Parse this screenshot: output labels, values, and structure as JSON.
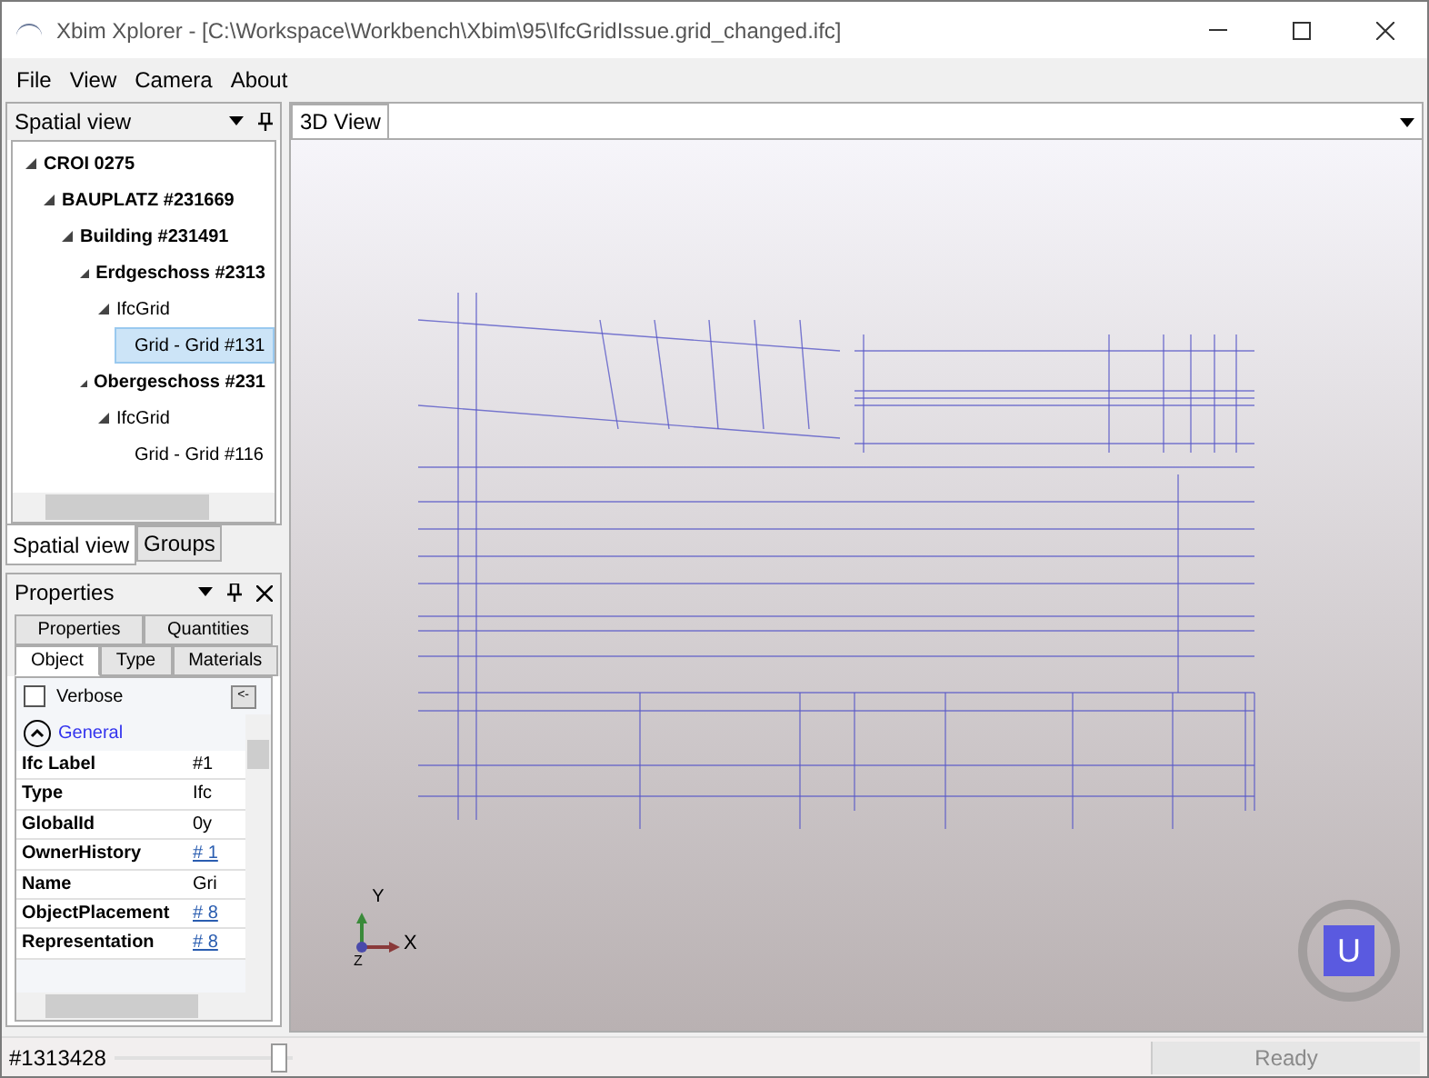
{
  "window": {
    "title": "Xbim Xplorer - [C:\\Workspace\\Workbench\\Xbim\\95\\IfcGridIssue.grid_changed.ifc]"
  },
  "menu": [
    "File",
    "View",
    "Camera",
    "About"
  ],
  "spatial_panel": {
    "title": "Spatial view",
    "tree": [
      {
        "label": "CROI 0275",
        "bold": true,
        "expanded": true,
        "selected": false,
        "children": [
          {
            "label": "BAUPLATZ #231669",
            "bold": true,
            "expanded": true,
            "selected": false,
            "children": [
              {
                "label": "Building #231491",
                "bold": true,
                "expanded": true,
                "selected": false,
                "children": [
                  {
                    "label": "Erdgeschoss #2313",
                    "bold": true,
                    "expanded": true,
                    "selected": false,
                    "children": [
                      {
                        "label": "IfcGrid",
                        "bold": false,
                        "expanded": true,
                        "selected": false,
                        "children": [
                          {
                            "label": "Grid - Grid #131",
                            "bold": false,
                            "selected": true
                          }
                        ]
                      }
                    ]
                  },
                  {
                    "label": "Obergeschoss #231",
                    "bold": true,
                    "expanded": true,
                    "selected": false,
                    "children": [
                      {
                        "label": "IfcGrid",
                        "bold": false,
                        "expanded": true,
                        "selected": false,
                        "children": [
                          {
                            "label": "Grid - Grid #116",
                            "bold": false,
                            "selected": false
                          }
                        ]
                      }
                    ]
                  }
                ]
              }
            ]
          }
        ]
      }
    ],
    "tabs": [
      {
        "label": "Spatial view",
        "selected": true
      },
      {
        "label": "Groups",
        "selected": false
      }
    ]
  },
  "properties_panel": {
    "title": "Properties",
    "tabs_row_1": [
      {
        "label": "Properties",
        "selected": false
      },
      {
        "label": "Quantities",
        "selected": false
      }
    ],
    "tabs_row_2": [
      {
        "label": "Object",
        "selected": true
      },
      {
        "label": "Type",
        "selected": false
      },
      {
        "label": "Materials",
        "selected": false
      }
    ],
    "verbose": {
      "label": "Verbose",
      "checked": false
    },
    "back_button": "<-",
    "section": "General",
    "rows": [
      {
        "name": "Ifc Label",
        "value": "#1",
        "link": false
      },
      {
        "name": "Type",
        "value": "Ifc",
        "link": false
      },
      {
        "name": "GlobalId",
        "value": "0y",
        "link": false
      },
      {
        "name": "OwnerHistory",
        "value": "# 1",
        "link": true
      },
      {
        "name": "Name",
        "value": "Gri",
        "link": false
      },
      {
        "name": "ObjectPlacement",
        "value": "# 8",
        "link": true
      },
      {
        "name": "Representation",
        "value": "# 8",
        "link": true
      }
    ]
  },
  "view_tab": {
    "label": "3D View",
    "selected": true
  },
  "axes": {
    "y": "Y",
    "z": "Z",
    "x": "X"
  },
  "navigator": "U",
  "status_bar": {
    "entity": "#1313428",
    "zoom": {
      "level": 0.97
    },
    "status": "Ready"
  }
}
